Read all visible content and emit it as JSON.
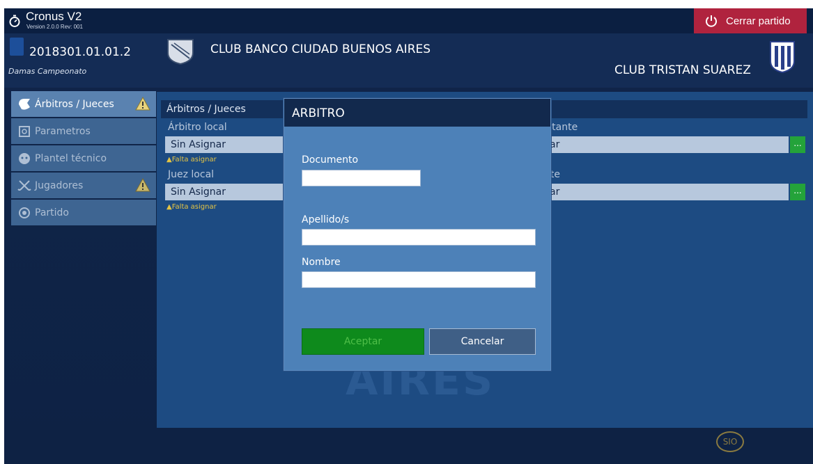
{
  "app": {
    "title": "Cronus V2",
    "version": "Version 2.0.0 Rev: 001",
    "close_label": "Cerrar partido"
  },
  "match": {
    "code": "2018301.01.01.2",
    "category": "Damas Campeonato",
    "club_local": "CLUB BANCO CIUDAD BUENOS AIRES",
    "club_visitor": "CLUB TRISTAN SUAREZ"
  },
  "sidebar": {
    "items": [
      {
        "label": "Árbitros / Jueces",
        "icon": "referee-icon",
        "warning": true
      },
      {
        "label": "Parametros",
        "icon": "settings-board-icon",
        "warning": false
      },
      {
        "label": "Plantel técnico",
        "icon": "coach-icon",
        "warning": false
      },
      {
        "label": "Jugadores",
        "icon": "sticks-icon",
        "warning": true
      },
      {
        "label": "Partido",
        "icon": "ball-icon",
        "warning": false
      }
    ]
  },
  "panel": {
    "title": "Árbitros / Jueces",
    "arbitro_local_label": "Árbitro local",
    "arbitro_local_value": "Sin Asignar",
    "arbitro_local_missing": "Falta asignar",
    "juez_local_label": "Juez local",
    "juez_local_value": "Sin Asignar",
    "juez_local_missing": "Falta asignar",
    "arbitro_visit_label": "sitante",
    "arbitro_visit_value": "ar",
    "juez_visit_label": "nte",
    "juez_visit_value": "ar",
    "dots": "..."
  },
  "watermark": "AIRES",
  "footer": {
    "logo": "SIO"
  },
  "modal": {
    "title": "ARBITRO",
    "documento_label": "Documento",
    "documento_value": "",
    "apellido_label": "Apellido/s",
    "apellido_value": "",
    "nombre_label": "Nombre",
    "nombre_value": "",
    "ok_label": "Aceptar",
    "cancel_label": "Cancelar"
  },
  "colors": {
    "close_button": "#b0233e",
    "accept_button": "#0e8a1c",
    "header_dark": "#12294d",
    "warning": "#e4c444"
  }
}
